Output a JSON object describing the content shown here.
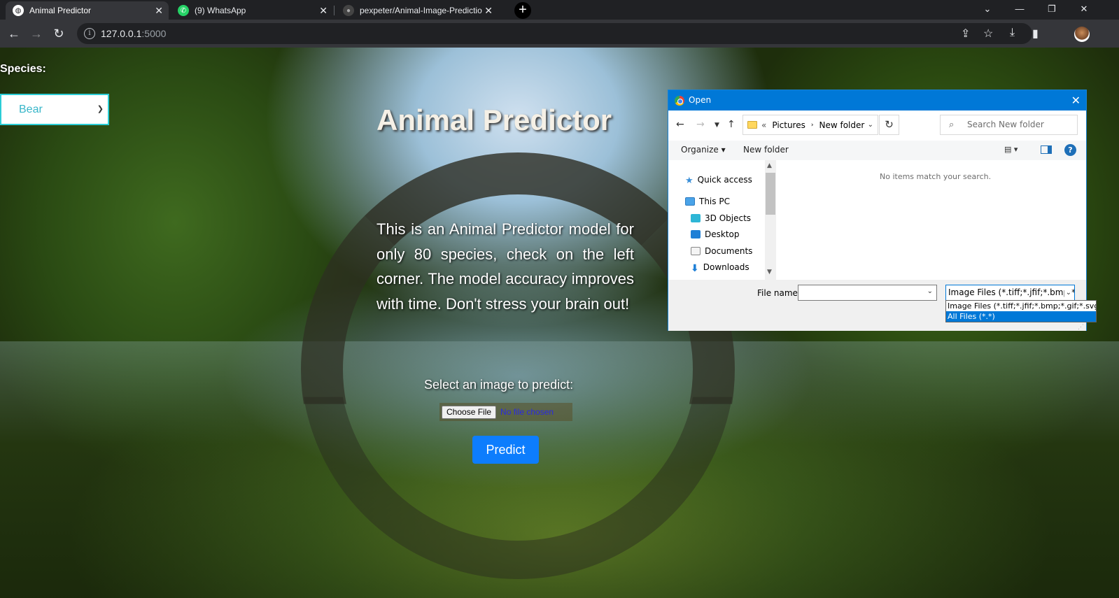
{
  "browser": {
    "tabs": [
      {
        "title": "Animal Predictor",
        "active": true
      },
      {
        "title": "(9) WhatsApp",
        "active": false
      },
      {
        "title": "pexpeter/Animal-Image-Predictio",
        "active": false
      }
    ],
    "url_host": "127.0.0.1",
    "url_port": ":5000"
  },
  "page": {
    "species_label": "Species:",
    "species_selected": "Bear",
    "title": "Animal Predictor",
    "intro": "This is an Animal Predictor model for only 80 species, check on the left corner. The model accuracy improves with time. Don't stress your brain out!",
    "select_label": "Select an image to predict:",
    "choose_file": "Choose File",
    "no_file": "No file chosen",
    "predict": "Predict"
  },
  "dialog": {
    "title": "Open",
    "breadcrumb": [
      "Pictures",
      "New folder"
    ],
    "search_placeholder": "Search New folder",
    "organize": "Organize",
    "new_folder": "New folder",
    "nav": {
      "quick_access": "Quick access",
      "this_pc": "This PC",
      "objects3d": "3D Objects",
      "desktop": "Desktop",
      "documents": "Documents",
      "downloads": "Downloads"
    },
    "empty_message": "No items match your search.",
    "file_name_label": "File name:",
    "file_type_selected": "Image Files (*.tiff;*.jfif;*.bmp;*.g",
    "file_type_options": [
      "Image Files (*.tiff;*.jfif;*.bmp;*.gif;*.svg;*.png",
      "All Files (*.*)"
    ]
  },
  "colors": {
    "predict_button": "#0d7dfd",
    "dialog_accent": "#0078d7",
    "select_border": "#2ccdd6"
  }
}
